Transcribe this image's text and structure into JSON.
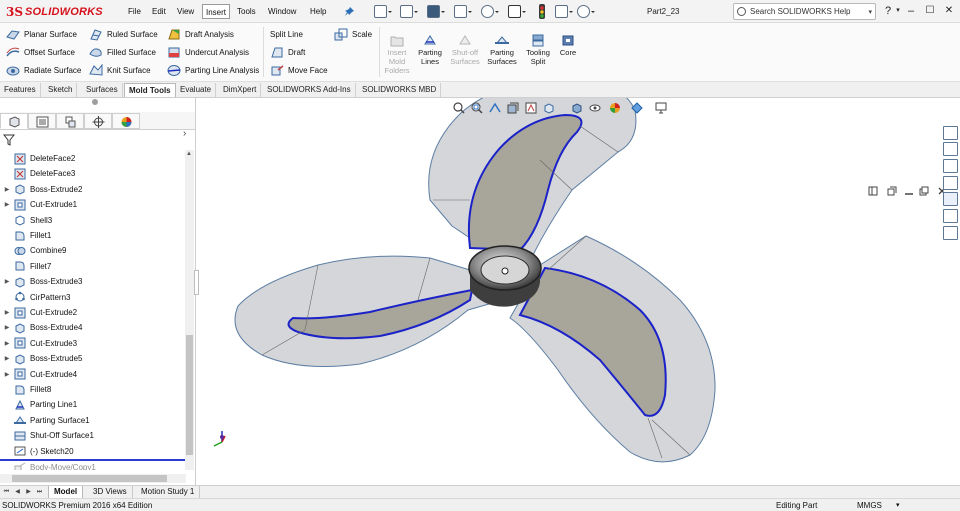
{
  "app": {
    "logo_prefix": "3S",
    "logo_text": "SOLIDWORKS",
    "doc_name": "Part2_23",
    "search_placeholder": "Search SOLIDWORKS Help",
    "help_glyph": "?",
    "close_glyph": "✕",
    "minimize_glyph": "–",
    "maximize_glyph": "☐",
    "dropdown_glyph": "▾"
  },
  "menu": [
    {
      "label": "File"
    },
    {
      "label": "Edit"
    },
    {
      "label": "View"
    },
    {
      "label": "Insert",
      "active": true
    },
    {
      "label": "Tools"
    },
    {
      "label": "Window"
    },
    {
      "label": "Help"
    }
  ],
  "command_manager": {
    "surface_commands": [
      {
        "label": "Planar Surface",
        "icon": "planar-surface-icon"
      },
      {
        "label": "Offset Surface",
        "icon": "offset-surface-icon"
      },
      {
        "label": "Radiate Surface",
        "icon": "radiate-surface-icon"
      },
      {
        "label": "Ruled Surface",
        "icon": "ruled-surface-icon"
      },
      {
        "label": "Filled Surface",
        "icon": "filled-surface-icon"
      },
      {
        "label": "Knit Surface",
        "icon": "knit-surface-icon"
      }
    ],
    "analysis_commands": [
      {
        "label": "Draft Analysis",
        "icon": "draft-analysis-icon"
      },
      {
        "label": "Undercut Analysis",
        "icon": "undercut-analysis-icon"
      },
      {
        "label": "Parting Line Analysis",
        "icon": "parting-line-analysis-icon"
      }
    ],
    "edit_commands": [
      {
        "label": "Split Line",
        "icon": "split-line-icon"
      },
      {
        "label": "Draft",
        "icon": "draft-icon"
      },
      {
        "label": "Move Face",
        "icon": "move-face-icon"
      },
      {
        "label": "Scale",
        "icon": "scale-icon"
      }
    ],
    "mold_tools": [
      {
        "label": "Insert Mold Folders",
        "line1": "Insert",
        "line2": "Mold",
        "line3": "Folders",
        "enabled": false
      },
      {
        "label": "Parting Lines",
        "line1": "Parting",
        "line2": "Lines",
        "line3": "",
        "enabled": true
      },
      {
        "label": "Shut-off Surfaces",
        "line1": "Shut-off",
        "line2": "Surfaces",
        "line3": "",
        "enabled": false
      },
      {
        "label": "Parting Surfaces",
        "line1": "Parting",
        "line2": "Surfaces",
        "line3": "",
        "enabled": true
      },
      {
        "label": "Tooling Split",
        "line1": "Tooling",
        "line2": "Split",
        "line3": "",
        "enabled": true
      },
      {
        "label": "Core",
        "line1": "Core",
        "line2": "",
        "line3": "",
        "enabled": true
      }
    ]
  },
  "tabs": [
    {
      "label": "Features"
    },
    {
      "label": "Sketch"
    },
    {
      "label": "Surfaces"
    },
    {
      "label": "Mold Tools",
      "active": true
    },
    {
      "label": "Evaluate"
    },
    {
      "label": "DimXpert"
    },
    {
      "label": "SOLIDWORKS Add-Ins"
    },
    {
      "label": "SOLIDWORKS MBD"
    }
  ],
  "feature_tree": [
    {
      "label": "DeleteFace2",
      "expandable": false,
      "icon": "delete-face-icon"
    },
    {
      "label": "DeleteFace3",
      "expandable": false,
      "icon": "delete-face-icon"
    },
    {
      "label": "Boss-Extrude2",
      "expandable": true,
      "icon": "boss-extrude-icon"
    },
    {
      "label": "Cut-Extrude1",
      "expandable": true,
      "icon": "cut-extrude-icon"
    },
    {
      "label": "Shell3",
      "expandable": false,
      "icon": "shell-icon"
    },
    {
      "label": "Fillet1",
      "expandable": false,
      "icon": "fillet-icon"
    },
    {
      "label": "Combine9",
      "expandable": false,
      "icon": "combine-icon"
    },
    {
      "label": "Fillet7",
      "expandable": false,
      "icon": "fillet-icon"
    },
    {
      "label": "Boss-Extrude3",
      "expandable": true,
      "icon": "boss-extrude-icon"
    },
    {
      "label": "CirPattern3",
      "expandable": false,
      "icon": "circular-pattern-icon"
    },
    {
      "label": "Cut-Extrude2",
      "expandable": true,
      "icon": "cut-extrude-icon"
    },
    {
      "label": "Boss-Extrude4",
      "expandable": true,
      "icon": "boss-extrude-icon"
    },
    {
      "label": "Cut-Extrude3",
      "expandable": true,
      "icon": "cut-extrude-icon"
    },
    {
      "label": "Boss-Extrude5",
      "expandable": true,
      "icon": "boss-extrude-icon"
    },
    {
      "label": "Cut-Extrude4",
      "expandable": true,
      "icon": "cut-extrude-icon"
    },
    {
      "label": "Fillet8",
      "expandable": false,
      "icon": "fillet-icon"
    },
    {
      "label": "Parting Line1",
      "expandable": false,
      "icon": "parting-line-icon"
    },
    {
      "label": "Parting Surface1",
      "expandable": false,
      "icon": "parting-surface-icon"
    },
    {
      "label": "Shut-Off Surface1",
      "expandable": false,
      "icon": "shut-off-surface-icon"
    },
    {
      "label": "(-) Sketch20",
      "expandable": false,
      "icon": "sketch-icon"
    },
    {
      "label": "Body-Move/Copy1",
      "expandable": false,
      "icon": "move-copy-icon",
      "rolled_back": true
    }
  ],
  "bottom_tabs": [
    {
      "label": "Model",
      "active": true
    },
    {
      "label": "3D Views"
    },
    {
      "label": "Motion Study 1"
    }
  ],
  "status": {
    "edition": "SOLIDWORKS Premium 2016 x64 Edition",
    "mode": "Editing Part",
    "units": "MMGS"
  },
  "colors": {
    "brand_red": "#d5121e",
    "part_surface": "#d4d6da",
    "blade_inner": "#a8a59a",
    "parting_line_blue": "#1b22c8",
    "rollback_bar": "#2c3bd0"
  }
}
